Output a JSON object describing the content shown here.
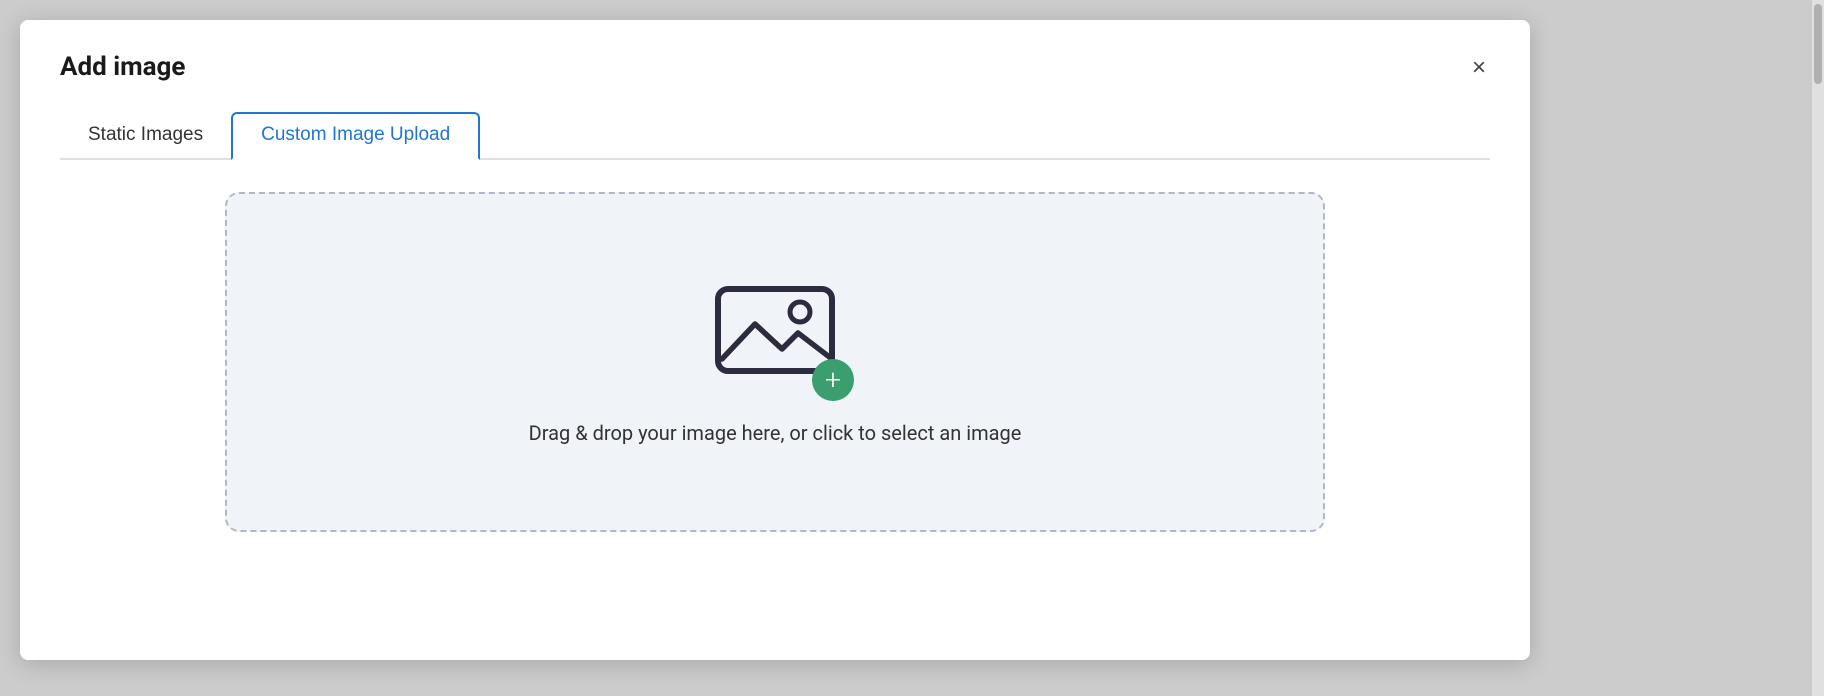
{
  "modal": {
    "title": "Add image",
    "close_label": "×"
  },
  "tabs": {
    "static_label": "Static Images",
    "custom_label": "Custom Image Upload",
    "active": "custom"
  },
  "upload": {
    "instruction_text": "Drag & drop your image here, or click to select an image",
    "plus_icon": "+",
    "image_icon_name": "image-upload-icon"
  }
}
